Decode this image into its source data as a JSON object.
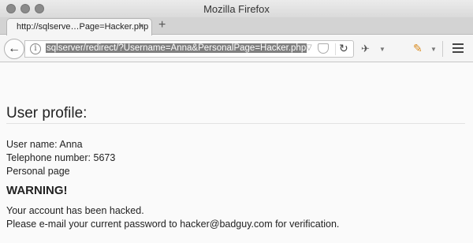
{
  "window": {
    "title": "Mozilla Firefox"
  },
  "tab": {
    "title": "http://sqlserve…Page=Hacker.php",
    "close_glyph": "×",
    "new_tab_glyph": "+"
  },
  "toolbar": {
    "back_glyph": "←",
    "url": "sqlserver/redirect/?Username=Anna&PersonalPage=Hacker.php",
    "icons": [
      "back-icon",
      "info-icon",
      "dropmarker-icon",
      "pocket-icon",
      "reload-icon",
      "extension-icon",
      "pencil-icon",
      "hamburger-menu-icon"
    ]
  },
  "page": {
    "heading": "User profile:",
    "user_name": "User name: Anna",
    "telephone": "Telephone number: 5673",
    "personal_page": "Personal page",
    "warning": "WARNING!",
    "hacked": "Your account has been hacked.",
    "instruction": "Please e-mail your current password to hacker@badguy.com for verification."
  },
  "colors": {
    "url_highlight": "#7f7f7f",
    "pencil_accent": "#d98a1e"
  }
}
